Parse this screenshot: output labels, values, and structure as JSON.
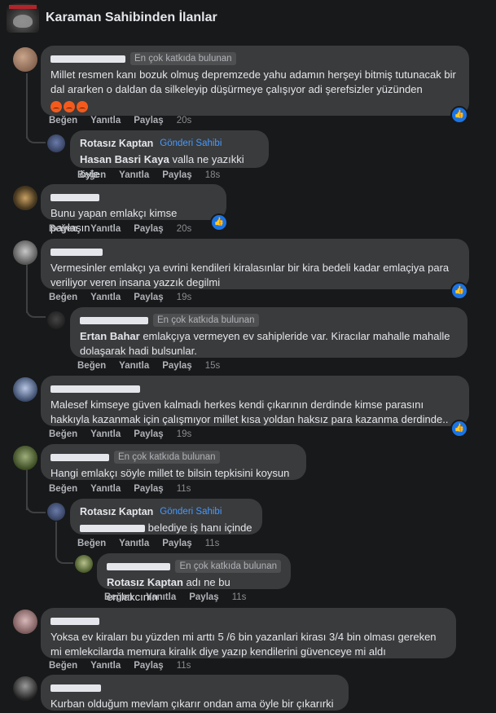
{
  "header": {
    "title": "Karaman Sahibinden İlanlar"
  },
  "actions": {
    "like": "Beğen",
    "reply": "Yanıtla",
    "share": "Paylaş"
  },
  "badges": {
    "top_fan": "En çok katkıda bulunan",
    "op": "Gönderi Sahibi"
  },
  "comments": [
    {
      "text": "Millet resmen kanı bozuk olmuş depremzede yahu adamın herşeyi bitmiş tutunacak bir dal ararken o daldan da silkeleyip düşürmeye çalışıyor adi şerefsizler yüzünden",
      "time": "20s"
    },
    {
      "author": "Rotasız Kaptan",
      "mention": "Hasan Basri Kaya",
      "text": " valla ne yazıkki öyle",
      "time": "18s"
    },
    {
      "text": "Bunu yapan emlakçı kimse paylaşın",
      "time": "20s"
    },
    {
      "text": "Vermesinler emlakçı ya evrini kendileri kiralasınlar bir kira bedeli kadar emlaçiya para veriliyor veren insana yazzık degilmi",
      "time": "19s"
    },
    {
      "mention": "Ertan Bahar",
      "text": " emlakçıya vermeyen ev sahipleride var. Kiracılar mahalle mahalle dolaşarak hadi bulsunlar.",
      "time": "15s"
    },
    {
      "text": "Malesef kimseye güven kalmadı herkes kendi çıkarının derdinde kimse parasını hakkıyla kazanmak için çalışmıyor millet kısa yoldan haksız para kazanma derdinde..",
      "time": "19s"
    },
    {
      "text": "Hangi emlakçı söyle millet te bilsin tepkisini koysun",
      "time": "11s"
    },
    {
      "author": "Rotasız Kaptan",
      "text": " belediye iş hanı içinde",
      "time": "11s"
    },
    {
      "mention": "Rotasız Kaptan",
      "text": " adı ne bu emlakcının",
      "time": "11s"
    },
    {
      "text": "Yoksa ev kiraları bu yüzden mi arttı 5 /6 bin yazanlari kirası 3/4 bin olması gereken mi emlekcilarda memura kiralık diye yazıp kendilerini güvenceye mi aldı",
      "time": "11s"
    },
    {
      "text": "Kurban olduğum mevlam çıkarır ondan ama öyle bir çıkarırki"
    }
  ]
}
